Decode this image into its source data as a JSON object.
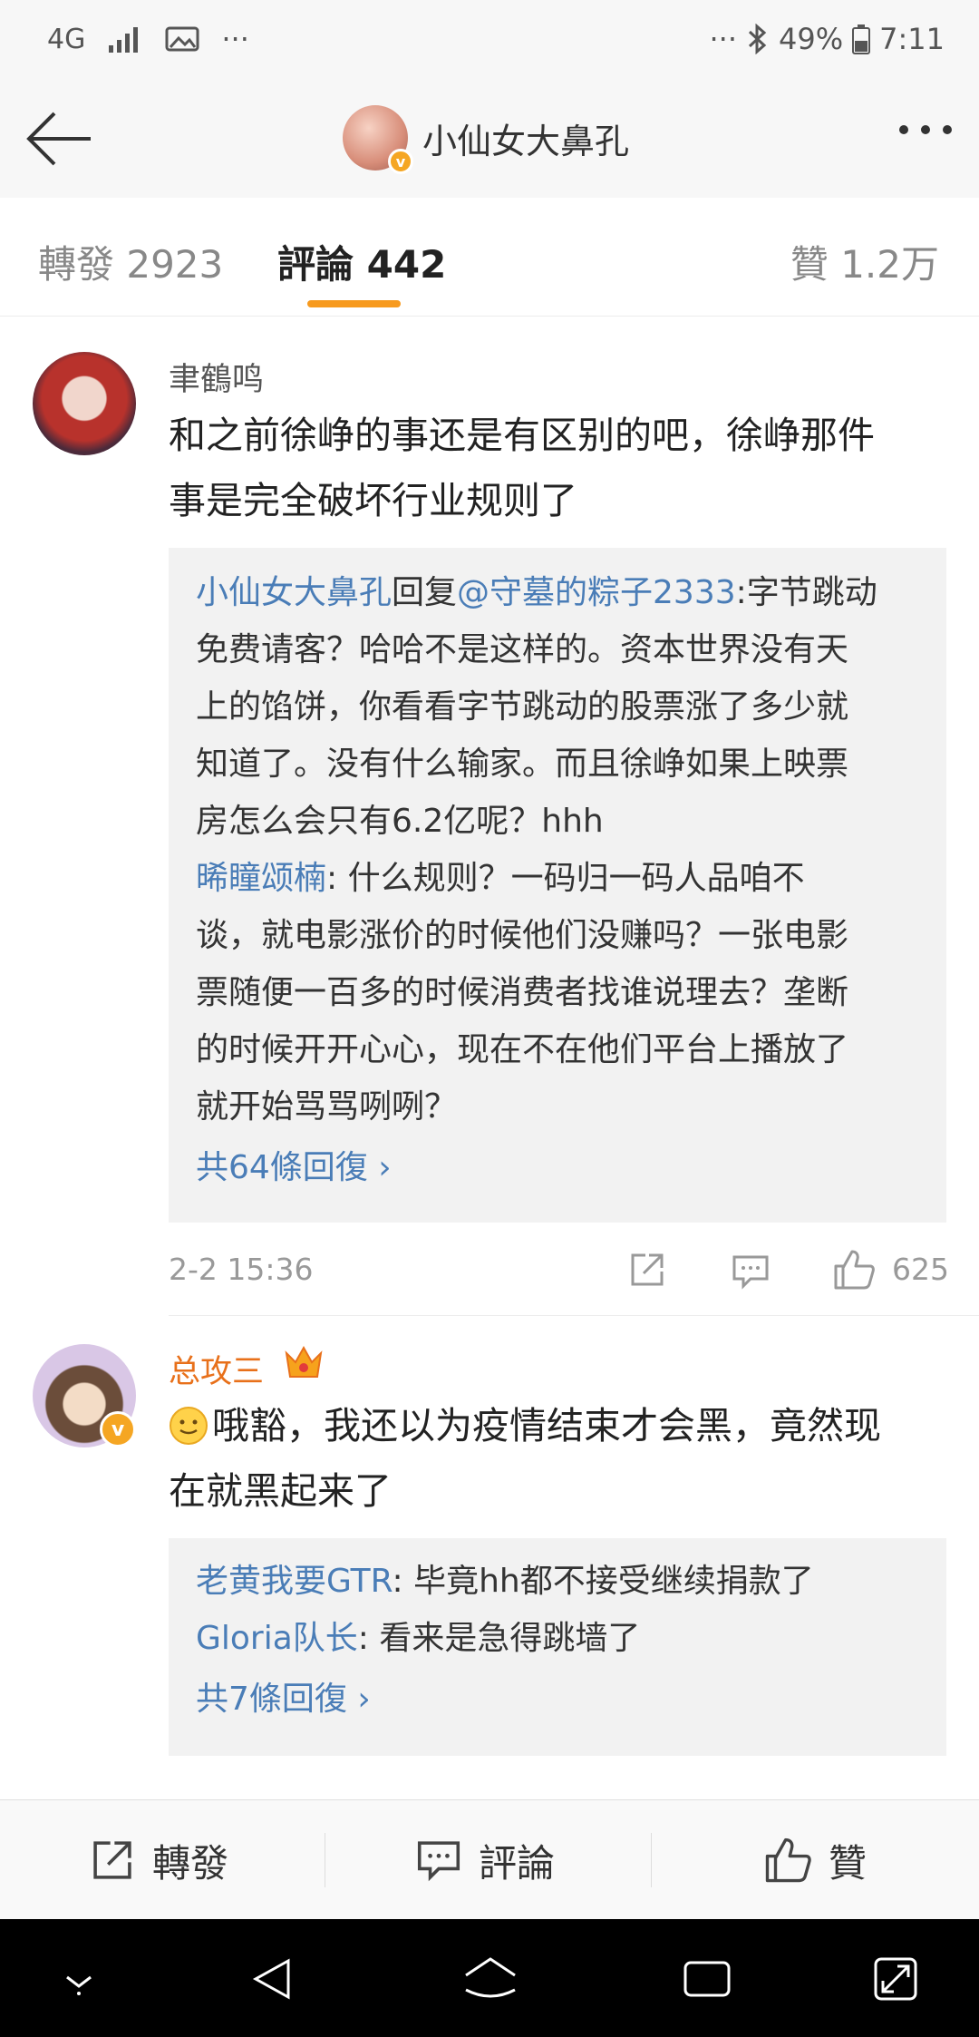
{
  "status_bar": {
    "network": "4G",
    "more": "···",
    "more_right": "···",
    "battery": "49%",
    "time": "7:11"
  },
  "header": {
    "title": "小仙女大鼻孔"
  },
  "tabs": [
    {
      "label": "轉發 2923"
    },
    {
      "label": "評論 442"
    },
    {
      "label": "贊 1.2万"
    }
  ],
  "comments": [
    {
      "user": "聿鶴鸣",
      "text_line1": "和之前徐峥的事还是有区别的吧，徐峥那件",
      "text_line2": "事是完全破坏行业规则了",
      "replies": {
        "r1_name": "小仙女大鼻孔",
        "r1_mid": "回复",
        "r1_mention": "@守墓的粽子2333",
        "r1_line1_rest": ":字节跳动",
        "r1_line2": "免费请客？哈哈不是这样的。资本世界没有天",
        "r1_line3": "上的馅饼，你看看字节跳动的股票涨了多少就",
        "r1_line4": "知道了。没有什么输家。而且徐峥如果上映票",
        "r1_line5": "房怎么会只有6.2亿呢？hhh",
        "r2_name": "晞瞳颂楠",
        "r2_line1_rest": ": 什么规则？一码归一码人品咱不",
        "r2_line2": "谈，就电影涨价的时候他们没赚吗？一张电影",
        "r2_line3": "票随便一百多的时候消费者找谁说理去？垄断",
        "r2_line4": "的时候开开心心，现在不在他们平台上播放了",
        "r2_line5": "就开始骂骂咧咧？",
        "more": "共64條回復 ›"
      },
      "time": "2-2 15:36",
      "likes": "625"
    },
    {
      "user": "总攻三",
      "text_line1": "哦豁，我还以为疫情结束才会黑，竟然现",
      "text_line2": "在就黑起来了",
      "replies": {
        "r1_name": "老黄我要GTR",
        "r1_rest": ": 毕竟hh都不接受继续捐款了",
        "r2_name": "Gloria队长",
        "r2_rest": ": 看来是急得跳墙了",
        "more": "共7條回復 ›"
      }
    }
  ],
  "toolbar": {
    "repost": "轉發",
    "comment": "評論",
    "like": "贊"
  },
  "colors": {
    "accent": "#f79a1e",
    "link": "#4a7db7",
    "vip_name": "#e8701a"
  }
}
